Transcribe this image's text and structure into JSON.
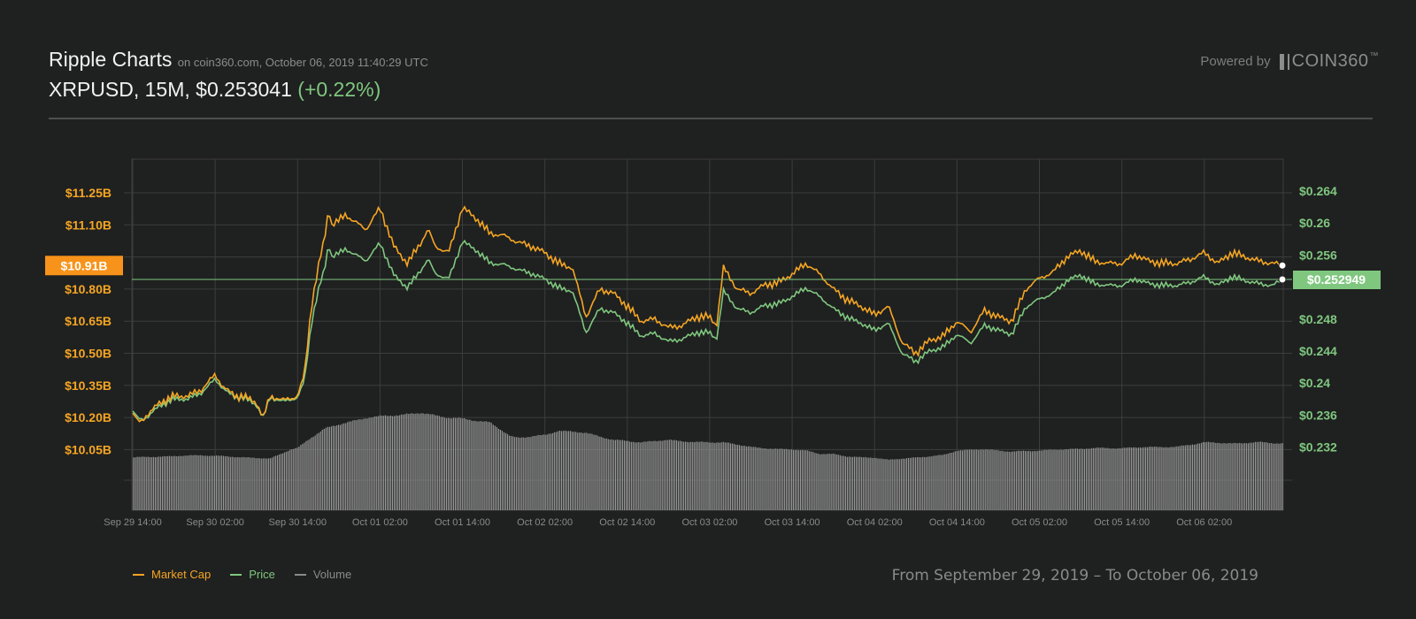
{
  "header": {
    "title": "Ripple Charts",
    "subtitle": "on coin360.com, October 06, 2019 11:40:29 UTC",
    "pair_info": "XRPUSD, 15M, $0.253041",
    "change": "(+0.22%)",
    "powered_by": "Powered by",
    "brand": "COIN360",
    "brand_tm": "™"
  },
  "legend": [
    {
      "label": "Market Cap",
      "color": "#f5a623"
    },
    {
      "label": "Price",
      "color": "#7fc77f"
    },
    {
      "label": "Volume",
      "color": "#8a8a8a"
    }
  ],
  "date_range": "From September 29, 2019 – To October 06, 2019",
  "colors": {
    "market_cap": "#f5a623",
    "price": "#7fc77f",
    "volume": "#9a9a9a",
    "grid": "#3c3d3d",
    "background": "#1f2020"
  },
  "chart_data": {
    "type": "line",
    "title": "",
    "x_ticks": [
      "Sep 29 14:00",
      "Sep 30 02:00",
      "Sep 30 14:00",
      "Oct 01 02:00",
      "Oct 01 14:00",
      "Oct 02 02:00",
      "Oct 02 14:00",
      "Oct 03 02:00",
      "Oct 03 14:00",
      "Oct 04 02:00",
      "Oct 04 14:00",
      "Oct 05 02:00",
      "Oct 05 14:00",
      "Oct 06 02:00"
    ],
    "x_range_hours": [
      0,
      167.5
    ],
    "left_axis": {
      "ticks": [
        "$11.25B",
        "$11.10B",
        "$10.80B",
        "$10.65B",
        "$10.50B",
        "$10.35B",
        "$10.20B",
        "$10.05B"
      ],
      "tick_values": [
        11.25,
        11.1,
        10.8,
        10.65,
        10.5,
        10.35,
        10.2,
        10.05
      ],
      "unit": "billion USD",
      "current_label": "$10.91B",
      "current_value": 10.91
    },
    "right_axis": {
      "ticks": [
        "$0.264",
        "$0.26",
        "$0.256",
        "$0.248",
        "$0.244",
        "$0.24",
        "$0.236",
        "$0.232"
      ],
      "tick_values": [
        0.264,
        0.26,
        0.256,
        0.248,
        0.244,
        0.24,
        0.236,
        0.232
      ],
      "current_label": "$0.252949",
      "current_value": 0.252949
    },
    "series": [
      {
        "name": "Market Cap",
        "axis": "left",
        "x": [
          0,
          1,
          2,
          4,
          6,
          8,
          10,
          12,
          13,
          14,
          15,
          16,
          18,
          19,
          20,
          22,
          24,
          25,
          26,
          27,
          28,
          28.5,
          29,
          30,
          31,
          32,
          34,
          36,
          38,
          40,
          42,
          43,
          44,
          46,
          48,
          50,
          52,
          54,
          56,
          58,
          60,
          62,
          64,
          66,
          68,
          70,
          72,
          74,
          76,
          78,
          80,
          82,
          84,
          85,
          86,
          88,
          90,
          92,
          94,
          96,
          98,
          100,
          102,
          104,
          106,
          108,
          110,
          112,
          114,
          116,
          118,
          120,
          122,
          124,
          126,
          128,
          130,
          132,
          134,
          136,
          138,
          140,
          142,
          144,
          146,
          148,
          150,
          152,
          154,
          156,
          158,
          160,
          162,
          164,
          166,
          167.5
        ],
        "values": [
          10.22,
          10.18,
          10.21,
          10.27,
          10.3,
          10.3,
          10.33,
          10.4,
          10.35,
          10.32,
          10.3,
          10.3,
          10.27,
          10.2,
          10.3,
          10.28,
          10.3,
          10.4,
          10.72,
          10.9,
          11.05,
          11.18,
          11.1,
          11.12,
          11.15,
          11.12,
          11.08,
          11.18,
          11.0,
          10.92,
          11.02,
          11.08,
          11.0,
          10.97,
          11.18,
          11.13,
          11.06,
          11.05,
          11.02,
          11.0,
          10.97,
          10.92,
          10.9,
          10.67,
          10.8,
          10.78,
          10.72,
          10.65,
          10.66,
          10.62,
          10.63,
          10.67,
          10.67,
          10.63,
          10.9,
          10.8,
          10.78,
          10.82,
          10.83,
          10.87,
          10.92,
          10.87,
          10.8,
          10.75,
          10.72,
          10.68,
          10.72,
          10.55,
          10.5,
          10.56,
          10.58,
          10.65,
          10.6,
          10.7,
          10.67,
          10.65,
          10.8,
          10.85,
          10.88,
          10.95,
          10.98,
          10.93,
          10.92,
          10.92,
          10.96,
          10.93,
          10.92,
          10.92,
          10.94,
          10.97,
          10.92,
          10.97,
          10.95,
          10.93,
          10.92,
          10.91
        ]
      },
      {
        "name": "Price",
        "axis": "right",
        "x": [
          0,
          1,
          2,
          4,
          6,
          8,
          10,
          12,
          13,
          14,
          15,
          16,
          18,
          19,
          20,
          22,
          24,
          25,
          26,
          27,
          28,
          28.5,
          29,
          30,
          31,
          32,
          34,
          36,
          38,
          40,
          42,
          43,
          44,
          46,
          48,
          50,
          52,
          54,
          56,
          58,
          60,
          62,
          64,
          66,
          68,
          70,
          72,
          74,
          76,
          78,
          80,
          82,
          84,
          85,
          86,
          88,
          90,
          92,
          94,
          96,
          98,
          100,
          102,
          104,
          106,
          108,
          110,
          112,
          114,
          116,
          118,
          120,
          122,
          124,
          126,
          128,
          130,
          132,
          134,
          136,
          138,
          140,
          142,
          144,
          146,
          148,
          150,
          152,
          154,
          156,
          158,
          160,
          162,
          164,
          166,
          167.5
        ],
        "values": [
          0.2365,
          0.2355,
          0.2357,
          0.2372,
          0.238,
          0.238,
          0.2388,
          0.2405,
          0.2395,
          0.2387,
          0.2382,
          0.2382,
          0.2373,
          0.2357,
          0.2382,
          0.2377,
          0.2382,
          0.2403,
          0.2475,
          0.2515,
          0.2545,
          0.2575,
          0.2558,
          0.2562,
          0.2568,
          0.2562,
          0.2553,
          0.2575,
          0.2535,
          0.2519,
          0.2542,
          0.2555,
          0.2537,
          0.253,
          0.2577,
          0.2566,
          0.255,
          0.2548,
          0.2542,
          0.2537,
          0.253,
          0.2519,
          0.2515,
          0.2463,
          0.2493,
          0.2488,
          0.2475,
          0.2459,
          0.2462,
          0.2452,
          0.2455,
          0.2463,
          0.2463,
          0.2455,
          0.2515,
          0.2493,
          0.2488,
          0.2497,
          0.2499,
          0.2508,
          0.2519,
          0.2508,
          0.2493,
          0.2482,
          0.2475,
          0.2466,
          0.2475,
          0.2437,
          0.2427,
          0.244,
          0.2445,
          0.2461,
          0.245,
          0.2472,
          0.2466,
          0.2461,
          0.2495,
          0.2505,
          0.2512,
          0.2528,
          0.2535,
          0.2524,
          0.2522,
          0.2522,
          0.253,
          0.2524,
          0.2522,
          0.2522,
          0.2526,
          0.2533,
          0.2522,
          0.2533,
          0.2528,
          0.2524,
          0.2522,
          0.252949
        ]
      },
      {
        "name": "Volume",
        "axis": "volume",
        "x": [
          0,
          10,
          20,
          23,
          24,
          26,
          28,
          34,
          36,
          40,
          42,
          46,
          48,
          52,
          55,
          56,
          60,
          62,
          66,
          70,
          74,
          78,
          82,
          86,
          90,
          94,
          96,
          98,
          100,
          102,
          104,
          106,
          108,
          110,
          112,
          114,
          116,
          118,
          120,
          124,
          128,
          132,
          136,
          140,
          144,
          148,
          152,
          156,
          160,
          164,
          167.5
        ],
        "values": [
          0.45,
          0.47,
          0.44,
          0.52,
          0.53,
          0.62,
          0.7,
          0.79,
          0.8,
          0.82,
          0.83,
          0.79,
          0.78,
          0.75,
          0.63,
          0.62,
          0.64,
          0.68,
          0.66,
          0.6,
          0.58,
          0.6,
          0.58,
          0.58,
          0.54,
          0.52,
          0.52,
          0.51,
          0.48,
          0.48,
          0.46,
          0.45,
          0.45,
          0.43,
          0.44,
          0.45,
          0.46,
          0.47,
          0.51,
          0.52,
          0.5,
          0.51,
          0.52,
          0.53,
          0.53,
          0.54,
          0.54,
          0.58,
          0.57,
          0.58,
          0.57
        ]
      }
    ],
    "grid": true,
    "legend_position": "bottom-left"
  }
}
